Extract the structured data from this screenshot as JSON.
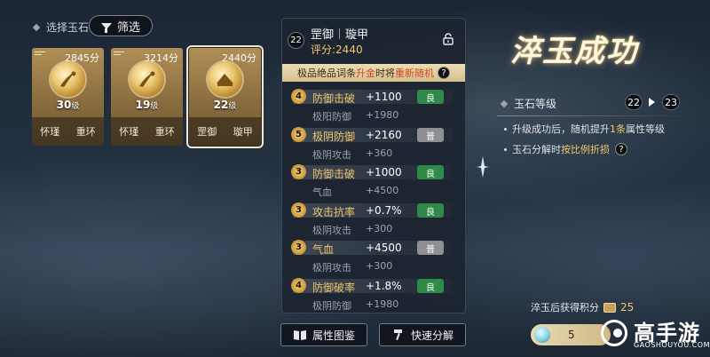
{
  "top_left": {
    "select_label": "选择玉石",
    "filter_label": "筛选"
  },
  "cards": [
    {
      "points": "2845分",
      "level": "30",
      "level_unit": "级",
      "names": [
        "怀瑾",
        "重环"
      ]
    },
    {
      "points": "3214分",
      "level": "19",
      "level_unit": "级",
      "names": [
        "怀瑾",
        "重环"
      ]
    },
    {
      "points": "2440分",
      "level": "22",
      "level_unit": "级",
      "names": [
        "罡御",
        "璇甲"
      ]
    }
  ],
  "panel": {
    "badge": "22",
    "name_a": "罡御",
    "name_b": "璇甲",
    "score": "评分:2440",
    "notice_pre": "极品绝品词条",
    "notice_hl1": "升金",
    "notice_mid": "时将",
    "notice_hl2": "重新随机",
    "help": "?",
    "attrs": [
      {
        "n": "4",
        "name": "防御击破",
        "value": "+1100",
        "tag": "良",
        "sub_name": "极阳防御",
        "sub_value": "+1980"
      },
      {
        "n": "5",
        "name": "极阴防御",
        "value": "+2160",
        "tag": "普",
        "sub_name": "极阴攻击",
        "sub_value": "+360"
      },
      {
        "n": "3",
        "name": "防御击破",
        "value": "+1000",
        "tag": "良",
        "sub_name": "气血",
        "sub_value": "+4500"
      },
      {
        "n": "3",
        "name": "攻击抗率",
        "value": "+0.7%",
        "tag": "良",
        "sub_name": "极阴攻击",
        "sub_value": "+300"
      },
      {
        "n": "3",
        "name": "气血",
        "value": "+4500",
        "tag": "普",
        "sub_name": "极阴攻击",
        "sub_value": "+300"
      },
      {
        "n": "4",
        "name": "防御破率",
        "value": "+1.8%",
        "tag": "良",
        "sub_name": "极阴防御",
        "sub_value": "+1980"
      }
    ]
  },
  "buttons": {
    "attr_book": "属性图鉴",
    "quick_decompose": "快速分解"
  },
  "right": {
    "title": "淬玉成功",
    "grade_label": "玉石等级",
    "grade_from": "22",
    "grade_to": "23",
    "line1_pre": "升级成功后，随机提升",
    "line1_hl": "1条",
    "line1_post": "属性等级",
    "line2_pre": "玉石分解时",
    "line2_hl": "按比例折损",
    "help": "?",
    "reward_label": "淬玉后获得积分",
    "reward_count": "25",
    "currency_value": "5"
  },
  "watermark": {
    "text": "高手游",
    "sub": "GAOSHOUYOU.COM"
  },
  "colors": {
    "gold": "#f1c96a",
    "good_tag": "#2f8a4a",
    "normal_tag": "#8c8f94"
  }
}
